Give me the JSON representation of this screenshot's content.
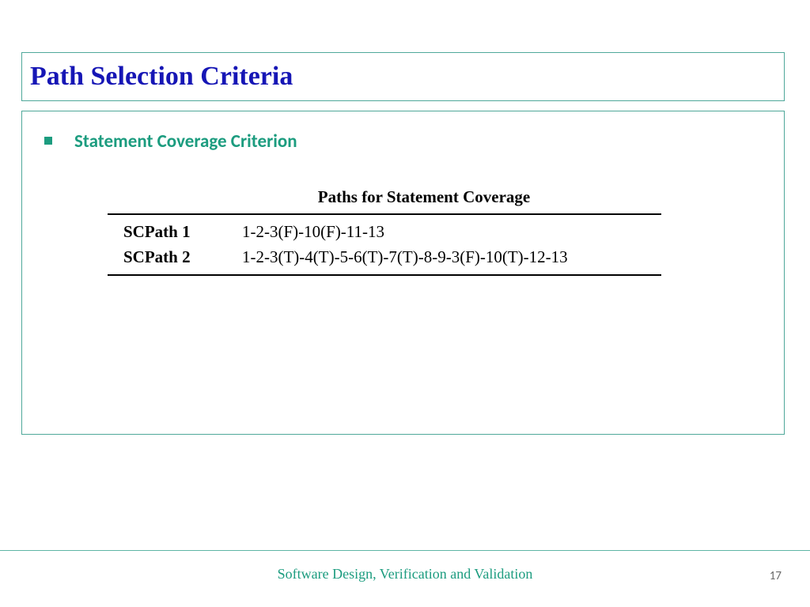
{
  "title": "Path Selection Criteria",
  "bullet": "Statement Coverage Criterion",
  "table": {
    "heading": "Paths for Statement Coverage",
    "rows": [
      {
        "label": "SCPath 1",
        "value": "1-2-3(F)-10(F)-11-13"
      },
      {
        "label": "SCPath 2",
        "value": "1-2-3(T)-4(T)-5-6(T)-7(T)-8-9-3(F)-10(T)-12-13"
      }
    ]
  },
  "footer": "Software Design,  Verification and Validation",
  "page_number": "17"
}
